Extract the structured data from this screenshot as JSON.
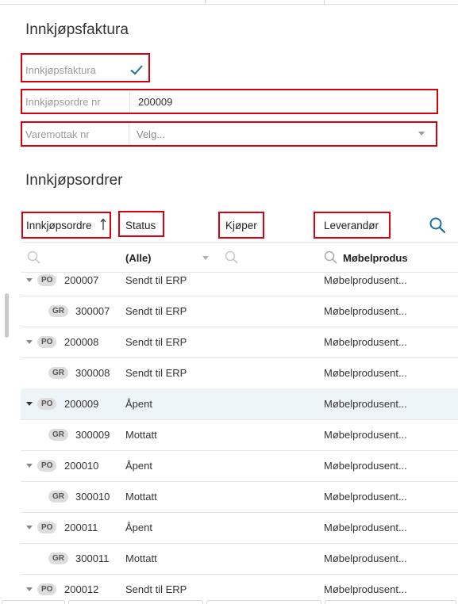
{
  "invoice_section": {
    "title": "Innkjøpsfaktura",
    "fields": {
      "invoice_checkbox": {
        "label": "Innkjøpsfaktura",
        "checked": true
      },
      "order_number": {
        "label": "Innkjøpsordre nr",
        "value": "200009"
      },
      "goods_receipt": {
        "label": "Varemottak nr",
        "placeholder": "Velg..."
      }
    }
  },
  "orders_section": {
    "title": "Innkjøpsordrer",
    "columns": {
      "order": {
        "label": "Innkjøpsordre",
        "sort_icon": "sort-ascending-icon"
      },
      "status": {
        "label": "Status"
      },
      "buyer": {
        "label": "Kjøper"
      },
      "supplier": {
        "label": "Leverandør"
      }
    },
    "filters": {
      "status_value": "(Alle)",
      "supplier_value": "Møbelprodus"
    },
    "rows": [
      {
        "type": "PO",
        "number": "200007",
        "status": "Sendt til ERP",
        "supplier": "Møbelprodusent..."
      },
      {
        "type": "GR",
        "number": "300007",
        "status": "Sendt til ERP",
        "supplier": "Møbelprodusent..."
      },
      {
        "type": "PO",
        "number": "200008",
        "status": "Sendt til ERP",
        "supplier": "Møbelprodusent..."
      },
      {
        "type": "GR",
        "number": "300008",
        "status": "Sendt til ERP",
        "supplier": "Møbelprodusent..."
      },
      {
        "type": "PO",
        "number": "200009",
        "status": "Åpent",
        "supplier": "Møbelprodusent..."
      },
      {
        "type": "GR",
        "number": "300009",
        "status": "Mottatt",
        "supplier": "Møbelprodusent..."
      },
      {
        "type": "PO",
        "number": "200010",
        "status": "Åpent",
        "supplier": "Møbelprodusent..."
      },
      {
        "type": "GR",
        "number": "300010",
        "status": "Mottatt",
        "supplier": "Møbelprodusent..."
      },
      {
        "type": "PO",
        "number": "200011",
        "status": "Åpent",
        "supplier": "Møbelprodusent..."
      },
      {
        "type": "GR",
        "number": "300011",
        "status": "Mottatt",
        "supplier": "Møbelprodusent..."
      },
      {
        "type": "PO",
        "number": "200012",
        "status": "Sendt til ERP",
        "supplier": "Møbelprodusent..."
      }
    ]
  },
  "colors": {
    "highlight_box": "#d9000d",
    "accent": "#1a6fa3",
    "selected_row": "#eef5f9"
  }
}
